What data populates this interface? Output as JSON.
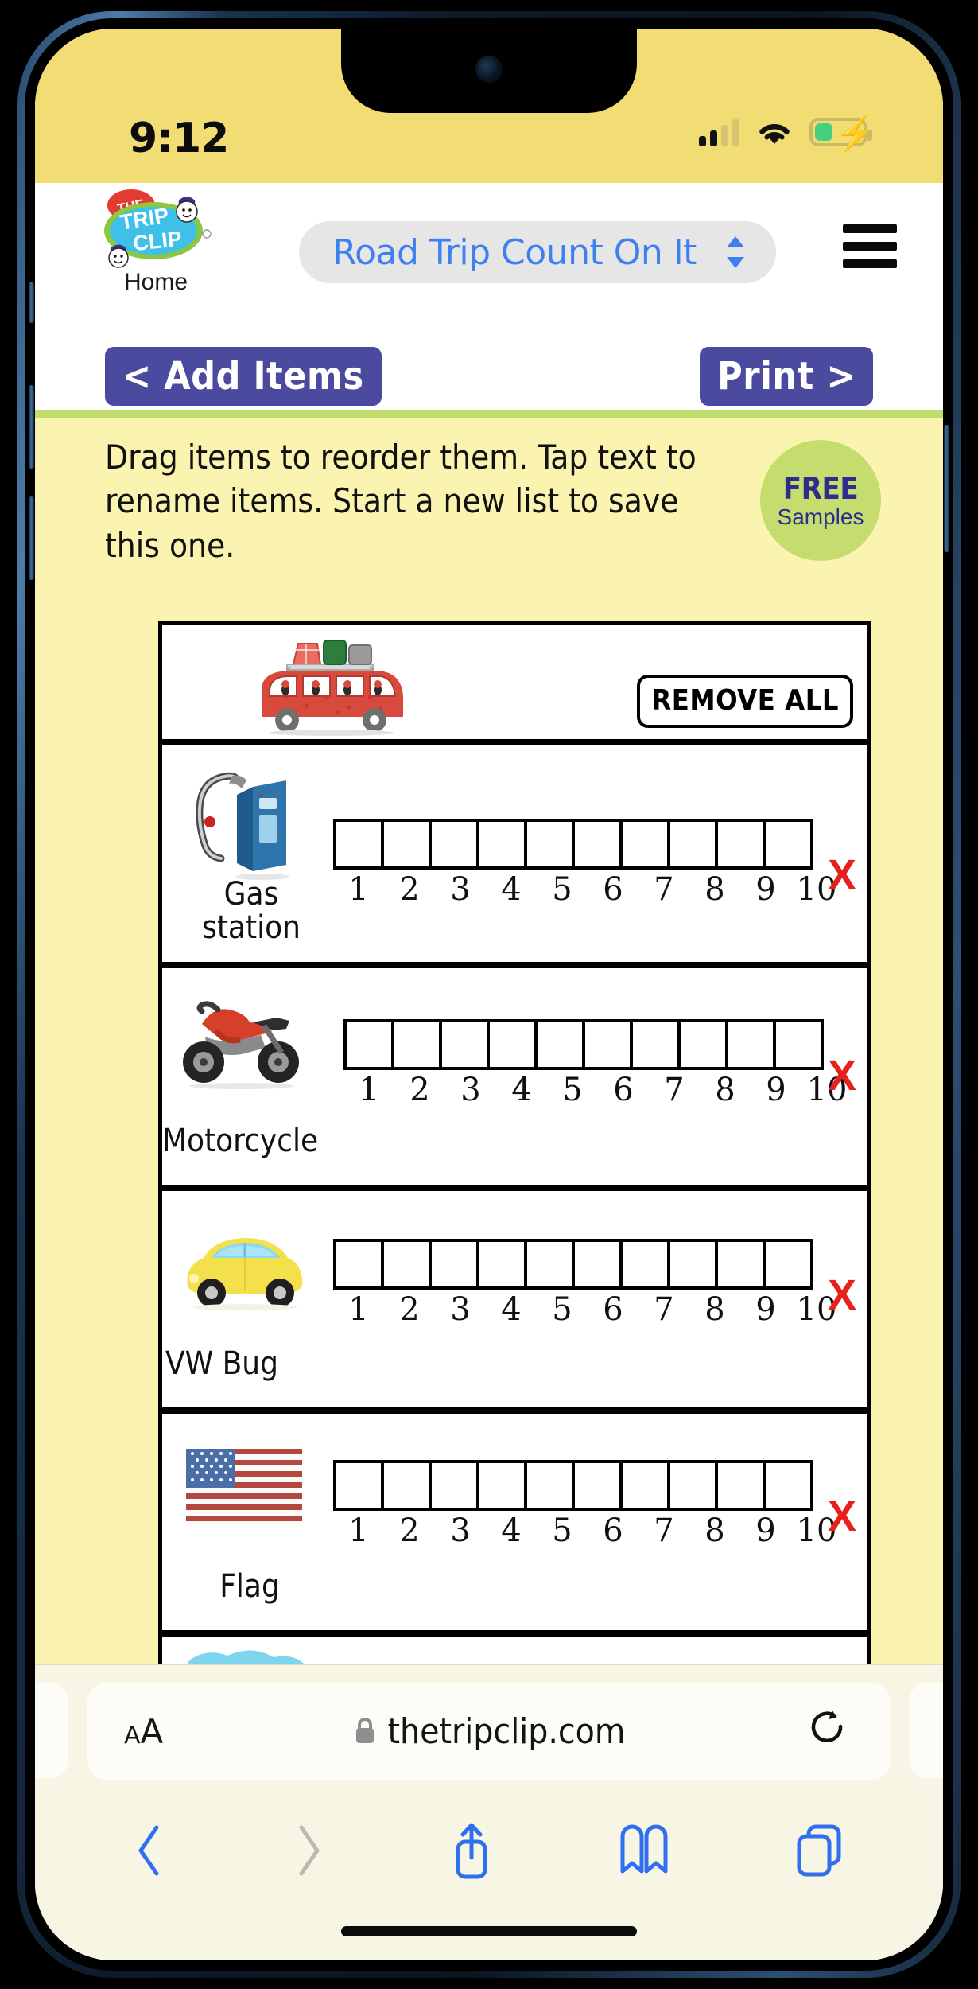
{
  "status_bar": {
    "time": "9:12",
    "signal_icon": "cellular-signal-icon",
    "wifi_icon": "wifi-icon",
    "battery_icon": "battery-charging-icon"
  },
  "header": {
    "logo_alt": "THE TRIP CLIP",
    "logo_the": "THE",
    "logo_trip": "TRIP",
    "logo_clip": "CLIP",
    "home_label": "Home",
    "selected_list": "Road Trip Count On It",
    "menu_icon": "hamburger-menu-icon"
  },
  "nav": {
    "add_items_label": "< Add Items",
    "print_label": "Print >"
  },
  "instructions": {
    "text": "Drag items to reorder them. Tap text to rename items. Start a new list to save this one.",
    "free_badge_line1": "FREE",
    "free_badge_line2": "Samples"
  },
  "list": {
    "header_image": "red-van-with-luggage",
    "remove_all_label": "REMOVE ALL",
    "count_numbers": [
      "1",
      "2",
      "3",
      "4",
      "5",
      "6",
      "7",
      "8",
      "9",
      "10"
    ],
    "remove_symbol": "X",
    "items": [
      {
        "label": "Gas\nstation",
        "label_line1": "Gas",
        "label_line2": "station",
        "art": "gas-pump"
      },
      {
        "label": "Motorcycle",
        "label_line1": "Motorcycle",
        "label_line2": "",
        "art": "motorcycle"
      },
      {
        "label": "VW Bug",
        "label_line1": "VW Bug",
        "label_line2": "",
        "art": "yellow-beetle-car"
      },
      {
        "label": "Flag",
        "label_line1": "Flag",
        "label_line2": "",
        "art": "usa-flag"
      },
      {
        "label": "",
        "label_line1": "",
        "label_line2": "",
        "art": "suspension-bridge"
      }
    ]
  },
  "browser": {
    "text_size_label": "AA",
    "lock_icon": "lock-icon",
    "url": "thetripclip.com",
    "reload_icon": "reload-icon",
    "back_icon": "chevron-left-icon",
    "forward_icon": "chevron-right-icon",
    "share_icon": "share-icon",
    "bookmarks_icon": "book-icon",
    "tabs_icon": "tabs-icon"
  },
  "colors": {
    "status_bar_bg": "#f2dd74",
    "page_bg": "#fbf4b0",
    "button_purple": "#4a4a9e",
    "accent_blue": "#3f80f0",
    "green_rule": "#c3dc6e",
    "badge_green": "#c5dd6f",
    "remove_red": "#e8201c"
  }
}
